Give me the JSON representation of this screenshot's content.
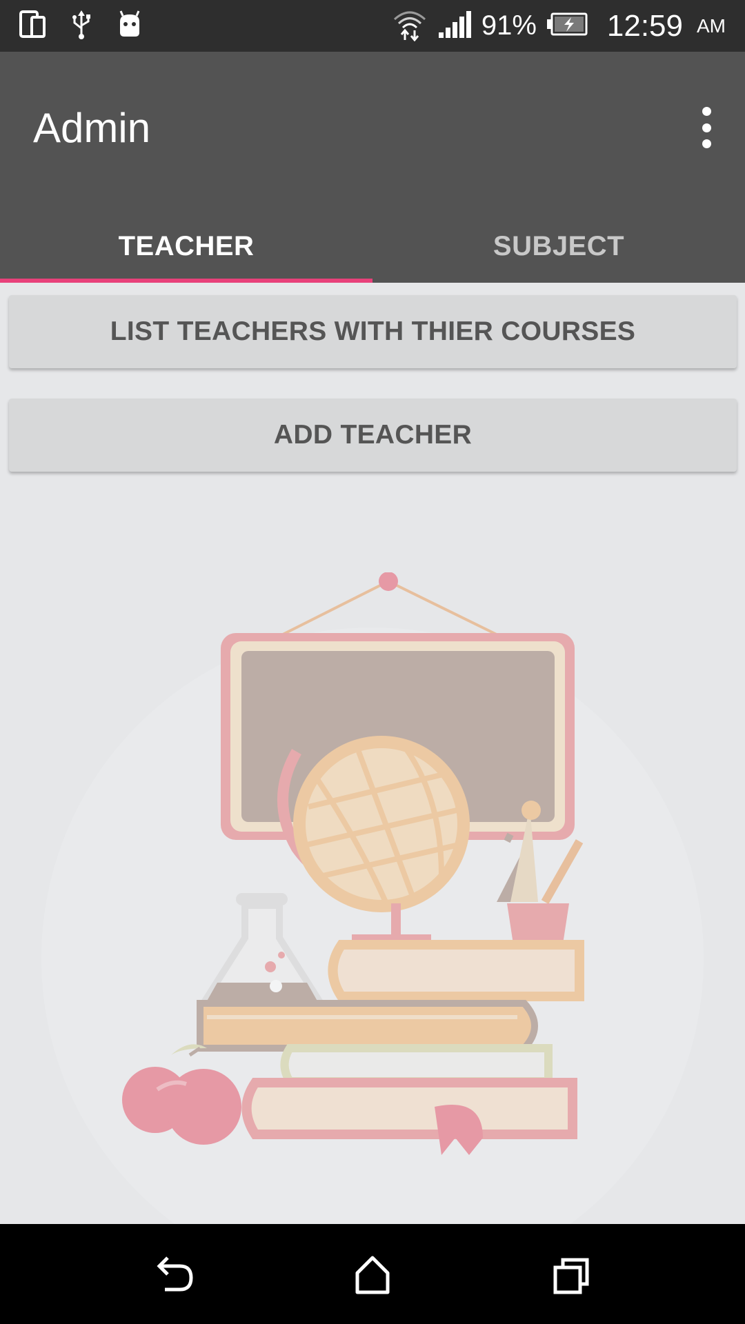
{
  "status_bar": {
    "battery_percent": "91%",
    "time": "12:59",
    "ampm": "AM",
    "icons": [
      "device-icon",
      "usb-icon",
      "android-icon",
      "wifi-icon",
      "signal-icon",
      "battery-charging-icon"
    ]
  },
  "app_bar": {
    "title": "Admin",
    "overflow_icon": "more-vert-icon"
  },
  "tabs": [
    {
      "label": "TEACHER",
      "selected": true
    },
    {
      "label": "SUBJECT",
      "selected": false
    }
  ],
  "actions": {
    "list_label": "LIST TEACHERS WITH THIER COURSES",
    "add_label": "ADD TEACHER"
  },
  "nav_bar": {
    "icons": [
      "back-icon",
      "home-icon",
      "recents-icon"
    ]
  },
  "colors": {
    "status_bar": "#2e2e2e",
    "app_bar": "#535353",
    "tab_indicator": "#e8417a",
    "background": "#e6e7e9",
    "button": "#d7d8d9",
    "button_text": "#555555"
  }
}
